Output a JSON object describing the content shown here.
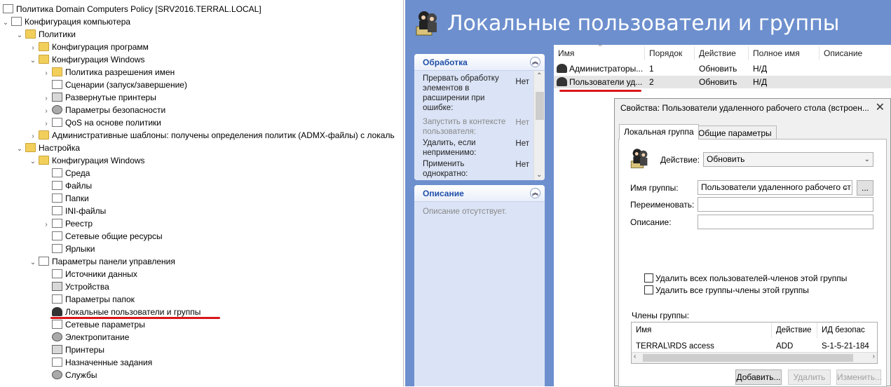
{
  "tree": {
    "items": [
      {
        "label": "Политика Domain Computers Policy [SRV2016.TERRAL.LOCAL]",
        "expander": "",
        "icon": "policy-doc-icon"
      },
      {
        "label": "Конфигурация компьютера",
        "expander": "⌄",
        "icon": "computer-icon"
      },
      {
        "label": "Политики",
        "expander": "⌄",
        "icon": "folder-icon"
      },
      {
        "label": "Конфигурация программ",
        "expander": "›",
        "icon": "folder-icon"
      },
      {
        "label": "Конфигурация Windows",
        "expander": "⌄",
        "icon": "folder-icon"
      },
      {
        "label": "Политика разрешения имен",
        "expander": "›",
        "icon": "folder-icon"
      },
      {
        "label": "Сценарии (запуск/завершение)",
        "expander": "",
        "icon": "script-icon"
      },
      {
        "label": "Развернутые принтеры",
        "expander": "›",
        "icon": "printer-icon"
      },
      {
        "label": "Параметры безопасности",
        "expander": "›",
        "icon": "security-icon"
      },
      {
        "label": "QoS на основе политики",
        "expander": "›",
        "icon": "qos-chart-icon"
      },
      {
        "label": "Административные шаблоны: получены определения политик (ADMX-файлы) с локаль",
        "expander": "›",
        "icon": "folder-icon"
      },
      {
        "label": "Настройка",
        "expander": "⌄",
        "icon": "folder-icon"
      },
      {
        "label": "Конфигурация Windows",
        "expander": "⌄",
        "icon": "folder-icon"
      },
      {
        "label": "Среда",
        "expander": "",
        "icon": "environment-icon"
      },
      {
        "label": "Файлы",
        "expander": "",
        "icon": "files-icon"
      },
      {
        "label": "Папки",
        "expander": "",
        "icon": "folders-icon"
      },
      {
        "label": "INI-файлы",
        "expander": "",
        "icon": "ini-file-icon"
      },
      {
        "label": "Реестр",
        "expander": "›",
        "icon": "registry-icon"
      },
      {
        "label": "Сетевые общие ресурсы",
        "expander": "",
        "icon": "network-share-icon"
      },
      {
        "label": "Ярлыки",
        "expander": "",
        "icon": "shortcut-icon"
      },
      {
        "label": "Параметры панели управления",
        "expander": "⌄",
        "icon": "control-panel-icon"
      },
      {
        "label": "Источники данных",
        "expander": "",
        "icon": "data-source-icon"
      },
      {
        "label": "Устройства",
        "expander": "",
        "icon": "devices-icon"
      },
      {
        "label": "Параметры папок",
        "expander": "",
        "icon": "folder-options-icon"
      },
      {
        "label": "Локальные пользователи и группы",
        "expander": "",
        "icon": "local-users-icon"
      },
      {
        "label": "Сетевые параметры",
        "expander": "",
        "icon": "network-options-icon"
      },
      {
        "label": "Электропитание",
        "expander": "",
        "icon": "power-icon"
      },
      {
        "label": "Принтеры",
        "expander": "",
        "icon": "printers-icon"
      },
      {
        "label": "Назначенные задания",
        "expander": "",
        "icon": "scheduled-tasks-icon"
      },
      {
        "label": "Службы",
        "expander": "",
        "icon": "services-icon"
      }
    ]
  },
  "banner": {
    "title": "Локальные пользователи и группы",
    "icon": "local-users-icon"
  },
  "processing": {
    "title": "Обработка",
    "rows": [
      {
        "label": "Прервать обработку элементов в расширении при ошибке:",
        "value": "Нет",
        "disabled": false
      },
      {
        "label": "Запустить в контексте пользователя:",
        "value": "Нет",
        "disabled": true
      },
      {
        "label": "Удалить, если неприменимо:",
        "value": "Нет",
        "disabled": false
      },
      {
        "label": "Применить однократно:",
        "value": "Нет",
        "disabled": false
      }
    ]
  },
  "description_box": {
    "title": "Описание",
    "text": "Описание отсутствует."
  },
  "list": {
    "columns": [
      "Имя",
      "Порядок",
      "Действие",
      "Полное имя",
      "Описание"
    ],
    "rows": [
      {
        "name": "Администраторы...",
        "order": "1",
        "action": "Обновить",
        "fullname": "Н/Д",
        "description": ""
      },
      {
        "name": "Пользователи уд...",
        "order": "2",
        "action": "Обновить",
        "fullname": "Н/Д",
        "description": ""
      }
    ]
  },
  "dialog": {
    "title": "Свойства: Пользователи удаленного рабочего стола (встроен...",
    "close": "✕",
    "tabs": [
      "Локальная группа",
      "Общие параметры"
    ],
    "action_label": "Действие:",
    "action_value": "Обновить",
    "group_name_label": "Имя группы:",
    "group_name_value": "Пользователи удаленного рабочего ст",
    "browse_label": "...",
    "rename_label": "Переименовать:",
    "rename_value": "",
    "description_label": "Описание:",
    "description_value": "",
    "delete_all_users_label": "Удалить всех пользователей-членов этой группы",
    "delete_all_groups_label": "Удалить все группы-члены этой группы",
    "members_label": "Члены группы:",
    "members_columns": [
      "Имя",
      "Действие",
      "ИД безопас"
    ],
    "members": [
      {
        "name": "TERRAL\\RDS access",
        "action": "ADD",
        "sid": "S-1-5-21-184"
      }
    ],
    "add_button": "Добавить...",
    "remove_button": "Удалить",
    "change_button": "Изменить..."
  }
}
